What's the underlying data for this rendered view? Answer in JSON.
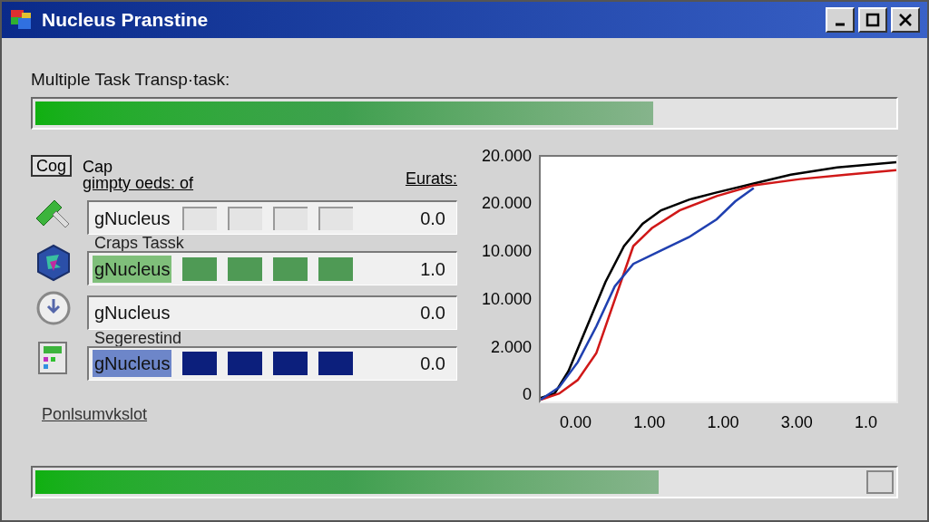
{
  "window": {
    "title": "Nucleus Pranstine"
  },
  "task": {
    "label": "Multiple Task Transp·task:",
    "level": 0.72
  },
  "panel": {
    "button": "Cog",
    "heading": "Cap",
    "subheading": "gimpty oeds: of",
    "column_label": "Eurats:",
    "rows": [
      {
        "kind": "outline",
        "value": "gNucleus",
        "reading": "0.0"
      },
      {
        "kind": "green",
        "caption": "Craps Tassk",
        "value": "gNucleus",
        "reading": "1.0"
      },
      {
        "kind": "blank",
        "value": "gNucleus",
        "reading": "0.0"
      },
      {
        "kind": "navy",
        "caption": "Segerestind",
        "value": "gNucleus",
        "reading": "0.0"
      }
    ],
    "footer": "Ponlsumvkslot"
  },
  "chart": {
    "y_labels": [
      "20.000",
      "20.000",
      "10.000",
      "10.000",
      "2.000",
      "0"
    ],
    "x_labels": [
      "0.00",
      "1.00",
      "1.00",
      "3.00",
      "1.0"
    ]
  },
  "bottom_progress": {
    "level": 0.75
  }
}
